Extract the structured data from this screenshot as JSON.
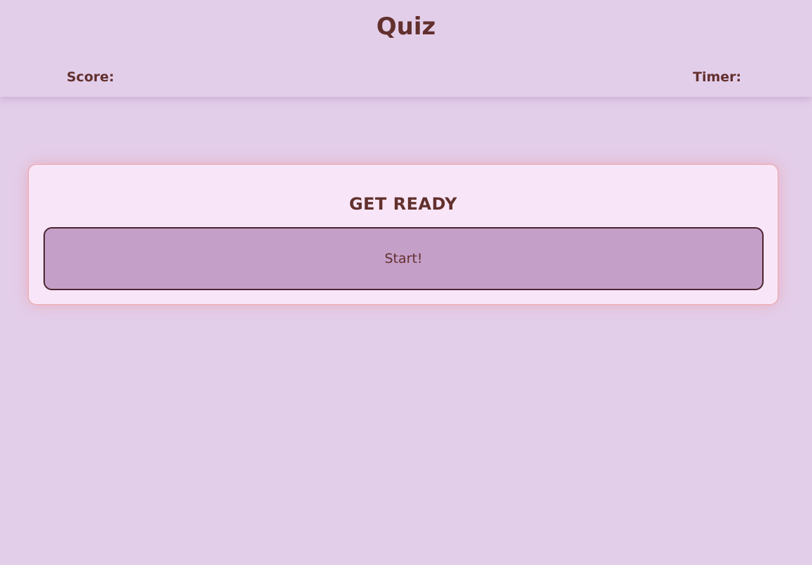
{
  "header": {
    "title": "Quiz",
    "score_label": "Score:",
    "timer_label": "Timer:"
  },
  "card": {
    "heading": "GET READY",
    "start_label": "Start!"
  },
  "colors": {
    "background": "#e3ceea",
    "text": "#62302d",
    "card_background": "#f8e6f8",
    "card_border": "#eba4a4",
    "button_background": "#c49fc8",
    "button_border": "#4c2430"
  }
}
